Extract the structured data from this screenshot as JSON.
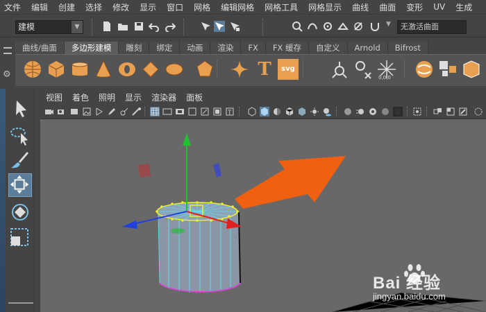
{
  "menu_bar": {
    "items": [
      "文件",
      "编辑",
      "创建",
      "选择",
      "修改",
      "显示",
      "窗口",
      "网格",
      "编辑网格",
      "网格工具",
      "网格显示",
      "曲线",
      "曲面",
      "变形",
      "UV",
      "生成"
    ]
  },
  "status_line": {
    "mode_value": "建模",
    "live_surface_label": "无激活曲面"
  },
  "shelf": {
    "tabs": [
      "曲线/曲面",
      "多边形建模",
      "雕刻",
      "绑定",
      "动画",
      "渲染",
      "FX",
      "FX 缓存",
      "自定义",
      "Arnold",
      "Bifrost"
    ],
    "active_tab": "多边形建模",
    "icons": [
      "poly-sphere-icon",
      "poly-cube-icon",
      "poly-cylinder-icon",
      "poly-cone-icon",
      "poly-torus-icon",
      "poly-plane-icon",
      "poly-disc-icon",
      "platonic-solid-icon",
      "super-shape-icon",
      "type-text-icon",
      "svg-icon",
      "measure-icon",
      "snap-center-icon",
      "combine-icon",
      "separate-icon",
      "extract-icon"
    ],
    "type_label": "T",
    "svg_label": "svg"
  },
  "toolbox": {
    "tools": [
      "select-tool-icon",
      "lasso-tool-icon",
      "paint-select-tool-icon",
      "move-tool-icon",
      "rotate-tool-icon",
      "scale-tool-icon"
    ]
  },
  "panel_menu": {
    "items": [
      "视图",
      "着色",
      "照明",
      "显示",
      "渲染器",
      "面板"
    ]
  },
  "watermark": {
    "brand": "Bai 经验",
    "site": "jingyan.baidu.com"
  },
  "colors": {
    "viewport_bg": "#686868",
    "accent_orange": "#f06010",
    "axis_x": "#e02020",
    "axis_y": "#20c030",
    "axis_z": "#2040e0",
    "wireframe": "#60d8e8",
    "selected_verts": "#f0f020"
  }
}
